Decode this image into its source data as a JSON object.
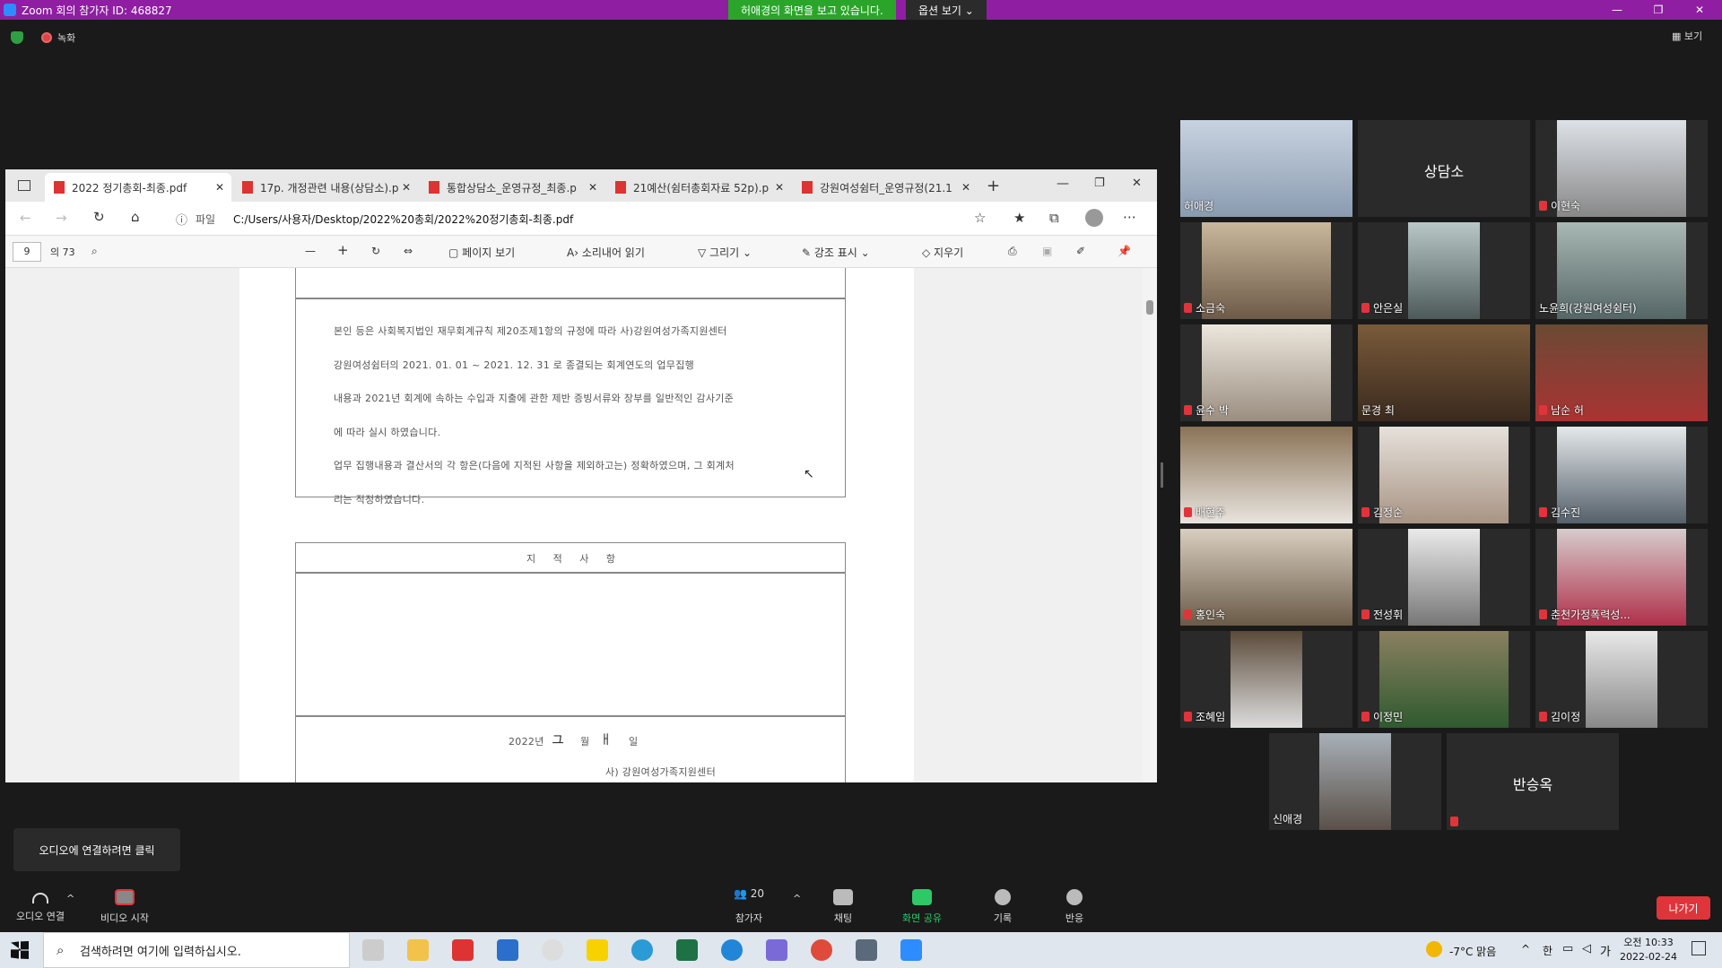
{
  "zoom": {
    "title": "Zoom 회의 참가자 ID: 468827",
    "share_banner": "허애경의 화면을 보고 있습니다.",
    "view_options": "옵션 보기 ⌄",
    "recording": "녹화",
    "view": "보기",
    "audio_tip": "오디오에 연결하려면 클릭",
    "participants_count": "20",
    "controls": [
      {
        "label": "오디오 연결"
      },
      {
        "label": "비디오 시작"
      },
      {
        "label": "참가자"
      },
      {
        "label": "채팅"
      },
      {
        "label": "화면 공유"
      },
      {
        "label": "기록"
      },
      {
        "label": "반응"
      }
    ],
    "leave": "나가기"
  },
  "browser": {
    "tabs": [
      {
        "label": "2022 정기총회-최종.pdf"
      },
      {
        "label": "17p. 개정관련 내용(상담소).p"
      },
      {
        "label": "통합상담소_운영규정_최종.p"
      },
      {
        "label": "21예산(쉼터총회자료 52p).p"
      },
      {
        "label": "강원여성쉼터_운영규정(21.1"
      }
    ],
    "file_label": "파일",
    "url": "C:/Users/사용자/Desktop/2022%20총회/2022%20정기총회-최종.pdf",
    "page_current": "9",
    "page_total": "의 73",
    "toolbar": {
      "page_view": "페이지 보기",
      "read_aloud": "소리내어 읽기",
      "draw": "그리기",
      "highlight": "강조 표시",
      "erase": "지우기"
    }
  },
  "document": {
    "lines": [
      "본인 등은 사회복지법인 재무회계규칙 제20조제1항의 규정에 따라 사)강원여성가족지원센터",
      "강원여성쉼터의 2021. 01. 01 ~ 2021. 12. 31 로 종결되는 회계연도의 업무집행",
      "내용과 2021년 회계에 속하는 수입과 지출에 관한 제반 증빙서류와 장부를 일반적인 감사기준",
      "에 따라 실시 하였습니다.",
      "업무 집행내용과 결산서의 각 항은(다음에 지적된 사항을 제외하고는) 정확하였으며, 그 회계처",
      "리는 적정하였습니다."
    ],
    "section_title": "지  적  사  항",
    "date_line": "2022년",
    "month_label": "월",
    "day_label": "일",
    "org": "사) 강원여성가족지원센터"
  },
  "participants": [
    {
      "name": "허애경",
      "muted": false
    },
    {
      "name": "상담소",
      "muted": false
    },
    {
      "name": "이현숙",
      "muted": true
    },
    {
      "name": "소금숙",
      "muted": true
    },
    {
      "name": "안은실",
      "muted": true
    },
    {
      "name": "노윤희(강원여성쉼터)",
      "muted": false
    },
    {
      "name": "윤수 박",
      "muted": true
    },
    {
      "name": "문경 최",
      "muted": false
    },
    {
      "name": "남순 허",
      "muted": true
    },
    {
      "name": "배현주",
      "muted": true
    },
    {
      "name": "김정순",
      "muted": true
    },
    {
      "name": "김수진",
      "muted": true
    },
    {
      "name": "홍인숙",
      "muted": true
    },
    {
      "name": "전성휘",
      "muted": true
    },
    {
      "name": "춘천가정폭력성...",
      "muted": true
    },
    {
      "name": "조혜임",
      "muted": true
    },
    {
      "name": "이정민",
      "muted": true
    },
    {
      "name": "김이정",
      "muted": true
    },
    {
      "name": "신애경",
      "muted": false
    },
    {
      "name": "반승옥",
      "muted": true
    }
  ],
  "taskbar": {
    "search_placeholder": "검색하려면 여기에 입력하십시오.",
    "weather": "-7°C 맑음",
    "ime": "한",
    "ime2": "가",
    "time": "오전 10:33",
    "date": "2022-02-24"
  }
}
